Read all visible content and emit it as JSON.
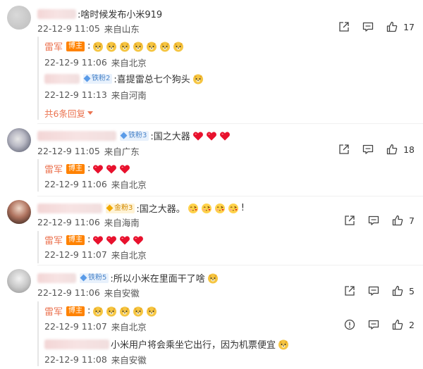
{
  "threads": [
    {
      "text": ":啥时候发布小米919",
      "time": "22-12-9 11:05",
      "location": "来自山东",
      "likes": "17",
      "replies": [
        {
          "user": "雷军",
          "badge": "博主",
          "text": ":",
          "emoji": [
            "doge",
            "doge",
            "doge",
            "doge",
            "doge",
            "doge",
            "doge"
          ],
          "time": "22-12-9 11:06",
          "location": "来自北京"
        },
        {
          "user": "",
          "badge": "铁粉2",
          "text": ":喜提雷总七个狗头",
          "emoji": [
            "doge"
          ],
          "time": "22-12-9 11:13",
          "location": "来自河南"
        }
      ],
      "more": "共6条回复"
    },
    {
      "badge": "铁粉3",
      "text": ":国之大器",
      "emoji": [
        "heart",
        "heart",
        "heart"
      ],
      "time": "22-12-9 11:05",
      "location": "来自广东",
      "likes": "18",
      "replies": [
        {
          "user": "雷军",
          "badge": "博主",
          "text": ":",
          "emoji": [
            "heart",
            "heart",
            "heart"
          ],
          "time": "22-12-9 11:06",
          "location": "来自北京"
        }
      ]
    },
    {
      "badge": "金粉3",
      "text": ":国之大器。",
      "emoji": [
        "kiss",
        "kiss",
        "kiss",
        "kiss"
      ],
      "tail": "!",
      "time": "22-12-9 11:06",
      "location": "来自海南",
      "likes": "7",
      "replies": [
        {
          "user": "雷军",
          "badge": "博主",
          "text": ":",
          "emoji": [
            "heart",
            "heart",
            "heart",
            "heart"
          ],
          "time": "22-12-9 11:07",
          "location": "来自北京"
        }
      ]
    },
    {
      "badge": "铁粉5",
      "text": ":所以小米在里面干了啥",
      "emoji": [
        "doge"
      ],
      "time": "22-12-9 11:06",
      "location": "来自安徽",
      "likes": "5",
      "replies": [
        {
          "user": "雷军",
          "badge": "博主",
          "text": ":",
          "emoji": [
            "doge",
            "doge",
            "doge",
            "doge",
            "doge"
          ],
          "time": "22-12-9 11:07",
          "location": "来自北京",
          "likes": "2"
        },
        {
          "user": "",
          "text": "小米用户将会乘坐它出行，因为机票便宜",
          "emoji": [
            "doge"
          ],
          "time": "22-12-9 11:08",
          "location": "来自安徽"
        }
      ]
    }
  ],
  "icons": {
    "share": "share-icon",
    "comment": "comment-icon",
    "like": "like-icon",
    "report": "report-icon"
  },
  "colors": {
    "username": "#eb7350",
    "host_badge": "#ff8200",
    "fan_badge": "#4b85c9"
  }
}
